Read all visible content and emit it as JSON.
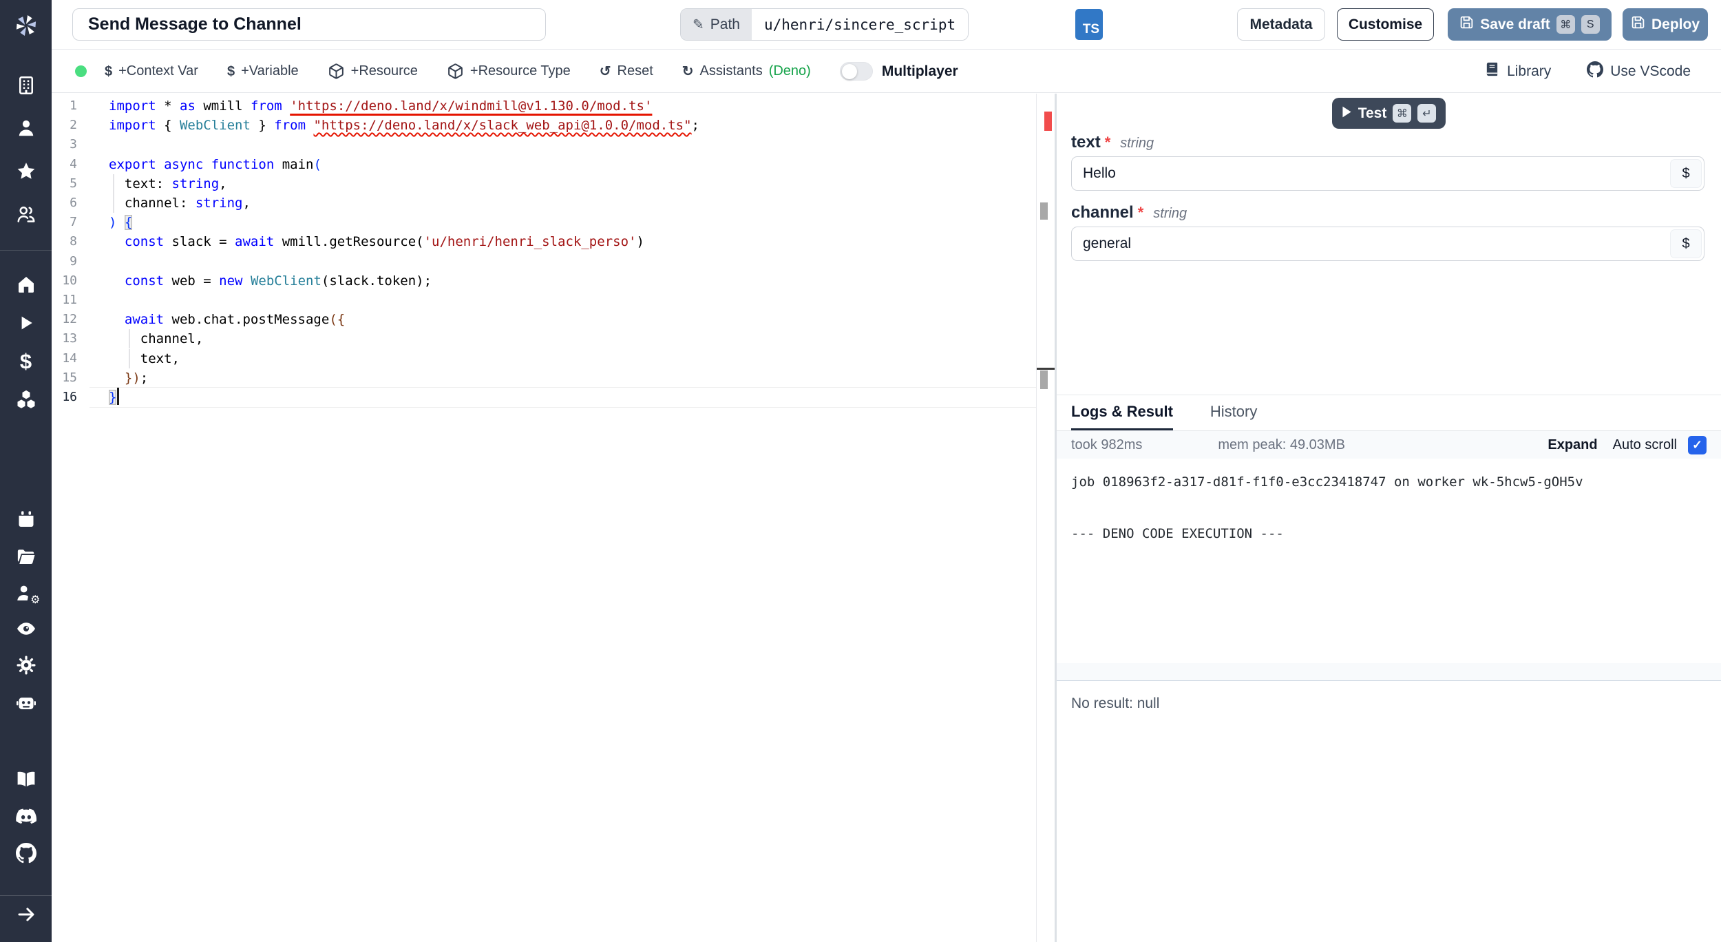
{
  "colors": {
    "sidebar-bg": "#293040",
    "primary": "#6283a7",
    "dark-btn": "#3d4859",
    "green-dot": "#4ade80",
    "deno-green": "#16a34a",
    "ts-blue": "#3178c6",
    "check-blue": "#2563eb",
    "error-red": "#e51400",
    "kw": "#0000ff",
    "str": "#a31515",
    "typ": "#267f99",
    "b1": "#0431fa",
    "b2": "#7b3814"
  },
  "topbar": {
    "title": "Send Message to Channel",
    "path_label": "Path",
    "path_value": "u/henri/sincere_script",
    "lang_badge": "TS",
    "metadata_label": "Metadata",
    "customise_label": "Customise",
    "save_draft_label": "Save draft",
    "save_keys": [
      "⌘",
      "S"
    ],
    "deploy_label": "Deploy"
  },
  "toolbar": {
    "items": [
      {
        "icon": "dollar-icon",
        "label": "+Context Var",
        "accent": ""
      },
      {
        "icon": "dollar-icon",
        "label": "+Variable",
        "accent": ""
      },
      {
        "icon": "cube-icon",
        "label": "+Resource",
        "accent": ""
      },
      {
        "icon": "cube-icon",
        "label": "+Resource Type",
        "accent": ""
      },
      {
        "icon": "rotate-ccw-icon",
        "label": "Reset",
        "accent": ""
      },
      {
        "icon": "refresh-cw-icon",
        "label": "Assistants ",
        "accent": "(Deno)"
      }
    ],
    "multiplayer_label": "Multiplayer",
    "multiplayer_on": false,
    "library_label": "Library",
    "vscode_label": "Use VScode"
  },
  "sidebar": {
    "icons": [
      "building",
      "user",
      "star",
      "users",
      "home",
      "play",
      "dollar",
      "boxes",
      "calendar",
      "folder",
      "user-cog",
      "eye",
      "settings",
      "bot",
      "book",
      "discord",
      "github",
      "arrow-right"
    ]
  },
  "editor": {
    "cursor_line": 16,
    "lines": [
      [
        [
          "k",
          "import"
        ],
        [
          "d",
          " "
        ],
        [
          "d",
          "*"
        ],
        [
          "d",
          " "
        ],
        [
          "k",
          "as"
        ],
        [
          "d",
          " wmill "
        ],
        [
          "k",
          "from"
        ],
        [
          "d",
          " "
        ],
        [
          "s us",
          "'https://deno.land/x/windmill@v1.130.0/mod.ts'"
        ]
      ],
      [
        [
          "k",
          "import"
        ],
        [
          "d",
          " { "
        ],
        [
          "t",
          "WebClient"
        ],
        [
          "d",
          " } "
        ],
        [
          "k",
          "from"
        ],
        [
          "d",
          " "
        ],
        [
          "s uw",
          "\"https://deno.land/x/slack_web_api@1.0.0/mod.ts\""
        ],
        [
          "d",
          ";"
        ]
      ],
      [],
      [
        [
          "k",
          "export"
        ],
        [
          "d",
          " "
        ],
        [
          "k",
          "async"
        ],
        [
          "d",
          " "
        ],
        [
          "k",
          "function"
        ],
        [
          "d",
          " main"
        ],
        [
          "b1",
          "("
        ]
      ],
      [
        [
          "d",
          "  text: "
        ],
        [
          "k",
          "string"
        ],
        [
          "d",
          ","
        ]
      ],
      [
        [
          "d",
          "  channel: "
        ],
        [
          "k",
          "string"
        ],
        [
          "d",
          ","
        ]
      ],
      [
        [
          "b1",
          ")"
        ],
        [
          "d",
          " "
        ],
        [
          "b1 match",
          "{"
        ]
      ],
      [
        [
          "d",
          "  "
        ],
        [
          "k",
          "const"
        ],
        [
          "d",
          " slack = "
        ],
        [
          "k",
          "await"
        ],
        [
          "d",
          " wmill.getResource("
        ],
        [
          "s",
          "'u/henri/henri_slack_perso'"
        ],
        [
          "d",
          ")"
        ]
      ],
      [],
      [
        [
          "d",
          "  "
        ],
        [
          "k",
          "const"
        ],
        [
          "d",
          " web = "
        ],
        [
          "k",
          "new"
        ],
        [
          "d",
          " "
        ],
        [
          "t",
          "WebClient"
        ],
        [
          "d",
          "(slack.token);"
        ]
      ],
      [],
      [
        [
          "d",
          "  "
        ],
        [
          "k",
          "await"
        ],
        [
          "d",
          " web.chat.postMessage"
        ],
        [
          "b2",
          "({"
        ]
      ],
      [
        [
          "d",
          "    channel,"
        ]
      ],
      [
        [
          "d",
          "    text,"
        ]
      ],
      [
        [
          "d",
          "  "
        ],
        [
          "b2",
          "})"
        ],
        [
          "d",
          ";"
        ]
      ],
      [
        [
          "b1 match",
          "}"
        ]
      ]
    ]
  },
  "panel": {
    "test_label": "Test",
    "test_keys": [
      "⌘",
      "↵"
    ],
    "fields": [
      {
        "name": "text",
        "required": "*",
        "type": "string",
        "value": "Hello",
        "addon": "$"
      },
      {
        "name": "channel",
        "required": "*",
        "type": "string",
        "value": "general",
        "addon": "$"
      }
    ],
    "tabs": [
      "Logs & Result",
      "History"
    ],
    "active_tab": 0,
    "took": "took 982ms",
    "mem": "mem peak: 49.03MB",
    "expand_label": "Expand",
    "autoscroll_label": "Auto scroll",
    "autoscroll_checked": true,
    "log_text": "job 018963f2-a317-d81f-f1f0-e3cc23418747 on worker wk-5hcw5-gOH5v\n\n\n--- DENO CODE EXECUTION ---",
    "result_text": "No result: null"
  }
}
